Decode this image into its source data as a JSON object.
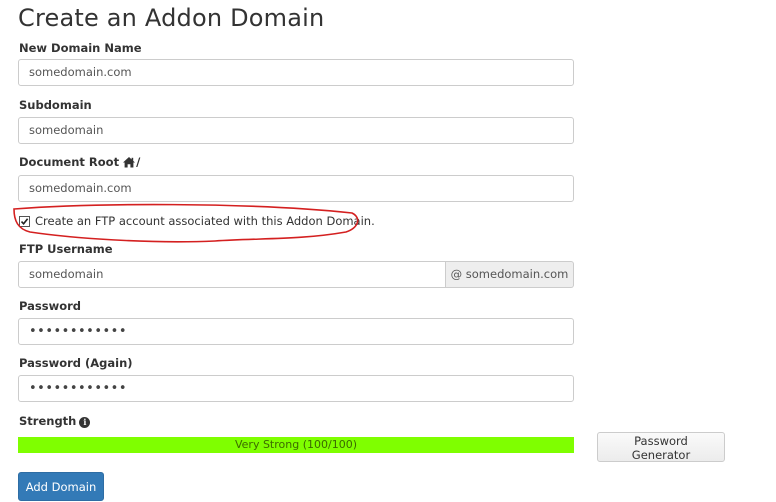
{
  "page": {
    "title": "Create an Addon Domain"
  },
  "form": {
    "new_domain": {
      "label": "New Domain Name",
      "value": "somedomain.com"
    },
    "subdomain": {
      "label": "Subdomain",
      "value": "somedomain"
    },
    "document_root": {
      "label": "Document Root",
      "suffix": "/",
      "value": "somedomain.com"
    },
    "ftp_checkbox": {
      "label": "Create an FTP account associated with this Addon Domain.",
      "checked": true
    },
    "ftp_username": {
      "label": "FTP Username",
      "value": "somedomain",
      "addon": "@ somedomain.com"
    },
    "password": {
      "label": "Password",
      "value": "••••••••••••"
    },
    "password_again": {
      "label": "Password (Again)",
      "value": "••••••••••••"
    },
    "strength": {
      "label": "Strength",
      "text": "Very Strong (100/100)",
      "level": 1.0,
      "color": "#7fff00"
    },
    "generator_button": "Password Generator",
    "submit_button": "Add Domain"
  },
  "annotation": {
    "color": "#d42020"
  },
  "icons": {
    "document_root": "home-icon",
    "strength_info": "info-icon",
    "checkbox": "checkmark-icon"
  }
}
